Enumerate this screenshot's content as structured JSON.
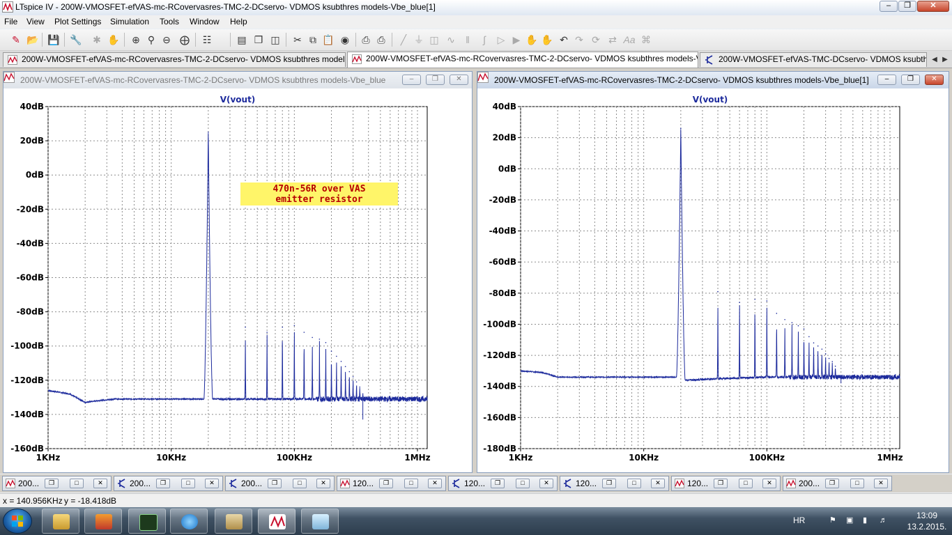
{
  "window": {
    "title": "LTspice IV - 200W-VMOSFET-efVAS-mc-RCovervasres-TMC-2-DCservo- VDMOS ksubthres models-Vbe_blue[1]"
  },
  "menu": [
    "File",
    "View",
    "Plot Settings",
    "Simulation",
    "Tools",
    "Window",
    "Help"
  ],
  "doc_tabs": [
    {
      "label": "200W-VMOSFET-efVAS-mc-RCovervasres-TMC-2-DCservo- VDMOS ksubthres models-Vbe_blue",
      "kind": "plot",
      "active": false
    },
    {
      "label": "200W-VMOSFET-efVAS-mc-RCovervasres-TMC-2-DCservo- VDMOS ksubthres models-Vbe_blue[1]",
      "kind": "plot",
      "active": true
    },
    {
      "label": "200W-VMOSFET-efVAS-TMC-DCservo- VDMOS ksubthres models-Vbe_blue",
      "kind": "schematic",
      "active": false
    }
  ],
  "plots": {
    "left": {
      "title": "200W-VMOSFET-efVAS-mc-RCovervasres-TMC-2-DCservo- VDMOS ksubthres models-Vbe_blue",
      "trace_name": "V(vout)",
      "annotation": [
        "470n-56R over VAS",
        "emitter resistor"
      ]
    },
    "right": {
      "title": "200W-VMOSFET-efVAS-mc-RCovervasres-TMC-2-DCservo- VDMOS ksubthres models-Vbe_blue[1]",
      "trace_name": "V(vout)"
    }
  },
  "chart_data": [
    {
      "type": "line",
      "title": "V(vout)",
      "x_scale": "log",
      "xlim": [
        1000,
        1200000
      ],
      "ylim": [
        -160,
        40
      ],
      "x_ticks": [
        "1KHz",
        "10KHz",
        "100KHz",
        "1MHz"
      ],
      "y_ticks": [
        "40dB",
        "20dB",
        "0dB",
        "-20dB",
        "-40dB",
        "-60dB",
        "-80dB",
        "-100dB",
        "-120dB",
        "-140dB",
        "-160dB"
      ],
      "grid": true,
      "series": [
        {
          "name": "V(vout)",
          "color": "#1c2a9c",
          "noise_floor": [
            [
              1000,
              -126
            ],
            [
              1500,
              -128
            ],
            [
              2000,
              -133
            ],
            [
              2500,
              -132
            ],
            [
              3500,
              -131
            ],
            [
              5000,
              -131
            ],
            [
              10000,
              -131
            ],
            [
              19000,
              -131
            ],
            [
              22000,
              -131
            ],
            [
              40000,
              -131
            ],
            [
              100000,
              -131
            ],
            [
              300000,
              -131
            ],
            [
              1200000,
              -131
            ]
          ],
          "fundamental": {
            "f": 20000,
            "db": 25
          },
          "harmonics": [
            [
              40000,
              -89
            ],
            [
              60000,
              -92
            ],
            [
              80000,
              -89
            ],
            [
              100000,
              -88
            ],
            [
              120000,
              -92
            ],
            [
              140000,
              -95
            ],
            [
              160000,
              -96
            ],
            [
              180000,
              -98
            ],
            [
              200000,
              -103
            ],
            [
              220000,
              -106
            ],
            [
              240000,
              -109
            ],
            [
              260000,
              -112
            ],
            [
              280000,
              -115
            ],
            [
              300000,
              -118
            ],
            [
              320000,
              -121
            ],
            [
              340000,
              -124
            ],
            [
              360000,
              -128
            ]
          ],
          "notable_dip": {
            "f": 360000,
            "db": -143
          }
        }
      ]
    },
    {
      "type": "line",
      "title": "V(vout)",
      "x_scale": "log",
      "xlim": [
        1000,
        1200000
      ],
      "ylim": [
        -180,
        40
      ],
      "x_ticks": [
        "1KHz",
        "10KHz",
        "100KHz",
        "1MHz"
      ],
      "y_ticks": [
        "40dB",
        "20dB",
        "0dB",
        "-20dB",
        "-40dB",
        "-60dB",
        "-80dB",
        "-100dB",
        "-120dB",
        "-140dB",
        "-160dB",
        "-180dB"
      ],
      "grid": true,
      "series": [
        {
          "name": "V(vout)",
          "color": "#1c2a9c",
          "noise_floor": [
            [
              1000,
              -130
            ],
            [
              1500,
              -131
            ],
            [
              2000,
              -134
            ],
            [
              3000,
              -134
            ],
            [
              5000,
              -134
            ],
            [
              10000,
              -134
            ],
            [
              19000,
              -134
            ],
            [
              22000,
              -136
            ],
            [
              40000,
              -135
            ],
            [
              100000,
              -134
            ],
            [
              300000,
              -134
            ],
            [
              1200000,
              -134
            ]
          ],
          "fundamental": {
            "f": 20000,
            "db": 26
          },
          "harmonics": [
            [
              40000,
              -79
            ],
            [
              60000,
              -86
            ],
            [
              80000,
              -84
            ],
            [
              100000,
              -85
            ],
            [
              120000,
              -93
            ],
            [
              140000,
              -97
            ],
            [
              160000,
              -99
            ],
            [
              180000,
              -101
            ],
            [
              200000,
              -103
            ],
            [
              220000,
              -108
            ],
            [
              240000,
              -112
            ],
            [
              260000,
              -114
            ],
            [
              280000,
              -116
            ],
            [
              300000,
              -119
            ],
            [
              320000,
              -122
            ],
            [
              340000,
              -124
            ],
            [
              360000,
              -127
            ]
          ],
          "notable_dip": {
            "f": 400000,
            "db": -138
          }
        }
      ]
    }
  ],
  "minimized": [
    {
      "label": "200...",
      "kind": "plot"
    },
    {
      "label": "200...",
      "kind": "schematic"
    },
    {
      "label": "200...",
      "kind": "schematic"
    },
    {
      "label": "120...",
      "kind": "plot"
    },
    {
      "label": "120...",
      "kind": "schematic"
    },
    {
      "label": "120...",
      "kind": "schematic"
    },
    {
      "label": "120...",
      "kind": "plot"
    },
    {
      "label": "200...",
      "kind": "plot"
    }
  ],
  "status": {
    "x": "x = 140.956KHz",
    "y": "y = -18.418dB"
  },
  "tray": {
    "lang": "HR",
    "time": "13:09",
    "date": "13.2.2015."
  },
  "icons": {
    "plot_icon": "waveform-icon",
    "schematic_icon": "transistor-icon",
    "accent": "#1c2a9c",
    "annotation_bg": "#fff569",
    "annotation_fg": "#b60000"
  }
}
